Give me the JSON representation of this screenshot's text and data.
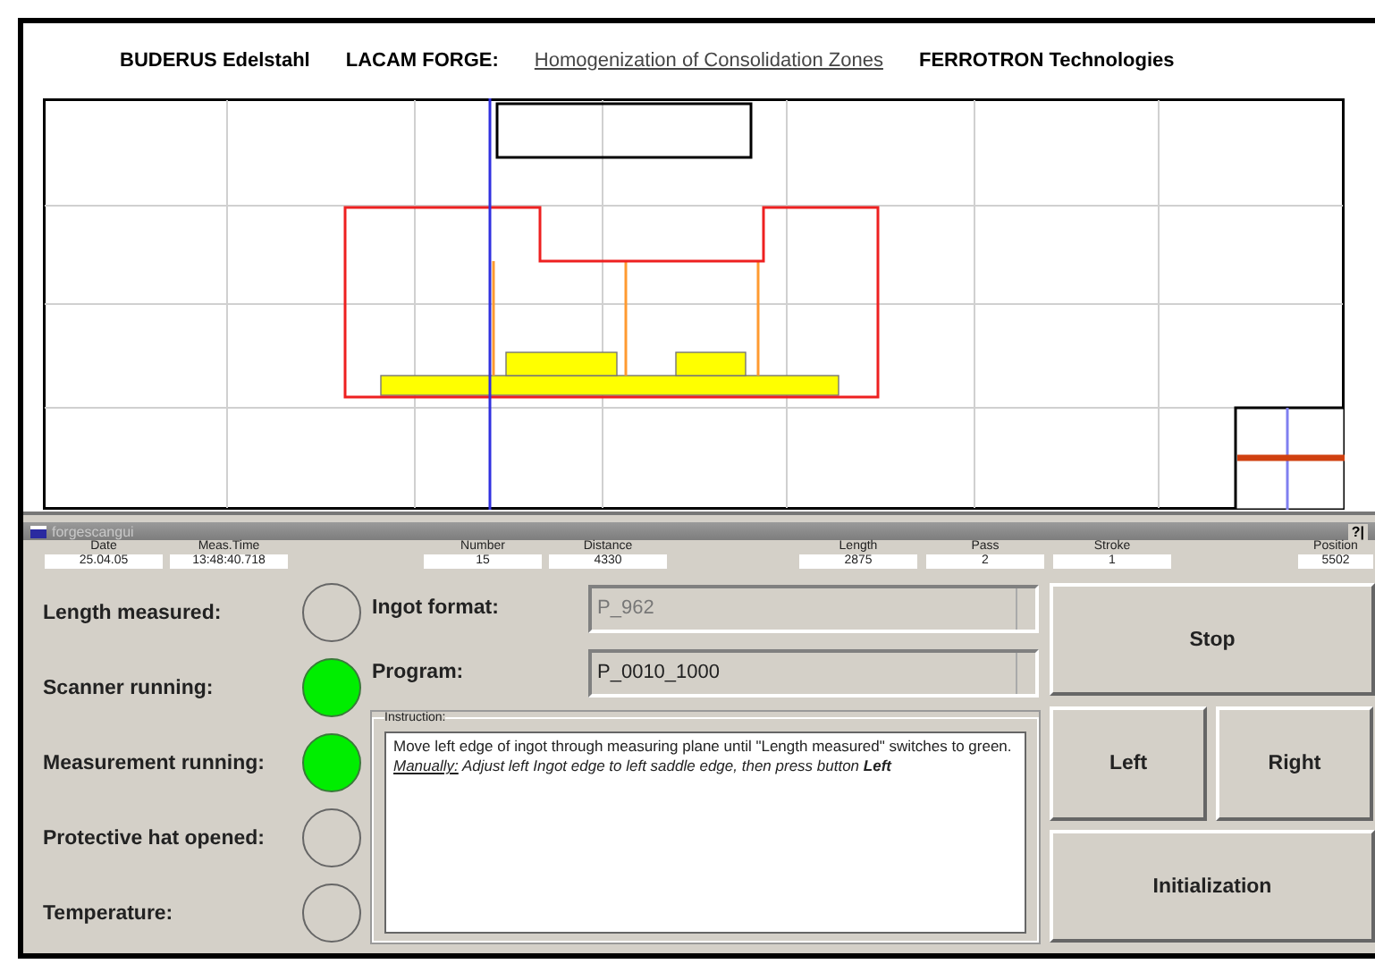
{
  "header": [
    {
      "kind": "plain",
      "text": "BUDERUS Edelstahl"
    },
    {
      "kind": "plain",
      "text": "LACAM FORGE:"
    },
    {
      "kind": "link",
      "text": "Homogenization of Consolidation Zones"
    },
    {
      "kind": "plain",
      "text": "FERROTRON Technologies"
    }
  ],
  "panel": {
    "title": "forgescangui",
    "help": "?|"
  },
  "readouts": [
    {
      "label": "Date",
      "value": "25.04.05"
    },
    {
      "label": "Meas.Time",
      "value": "13:48:40.718"
    },
    {
      "label": "Number",
      "value": "15"
    },
    {
      "label": "Distance",
      "value": "4330"
    },
    {
      "label": "Length",
      "value": "2875"
    },
    {
      "label": "Pass",
      "value": "2"
    },
    {
      "label": "Stroke",
      "value": "1"
    },
    {
      "label": "Position",
      "value": "5502"
    }
  ],
  "status_lights": [
    {
      "label": "Length measured:",
      "on": false
    },
    {
      "label": "Scanner running:",
      "on": true
    },
    {
      "label": "Measurement running:",
      "on": true
    },
    {
      "label": "Protective hat opened:",
      "on": false
    },
    {
      "label": "Temperature:",
      "on": false
    }
  ],
  "fields": [
    {
      "label": "Ingot format:",
      "value": "P_962",
      "disabled": true
    },
    {
      "label": "Program:",
      "value": "P_0010_1000",
      "disabled": false
    }
  ],
  "instruction": {
    "legend": "Instruction:",
    "lines": [
      {
        "kind": "plain",
        "text": "Move left edge of ingot through measuring plane until \"Length measured\" switches to green."
      },
      {
        "kind": "note",
        "lead": "Manually:",
        "text": "Adjust left Ingot edge to left saddle edge, then press button **Left**"
      }
    ]
  },
  "buttons": [
    {
      "kind": "wide",
      "label": "Stop"
    },
    {
      "kind": "half",
      "label": "Left"
    },
    {
      "kind": "half",
      "label": "Right"
    },
    {
      "kind": "wide",
      "label": "Initialization"
    }
  ]
}
